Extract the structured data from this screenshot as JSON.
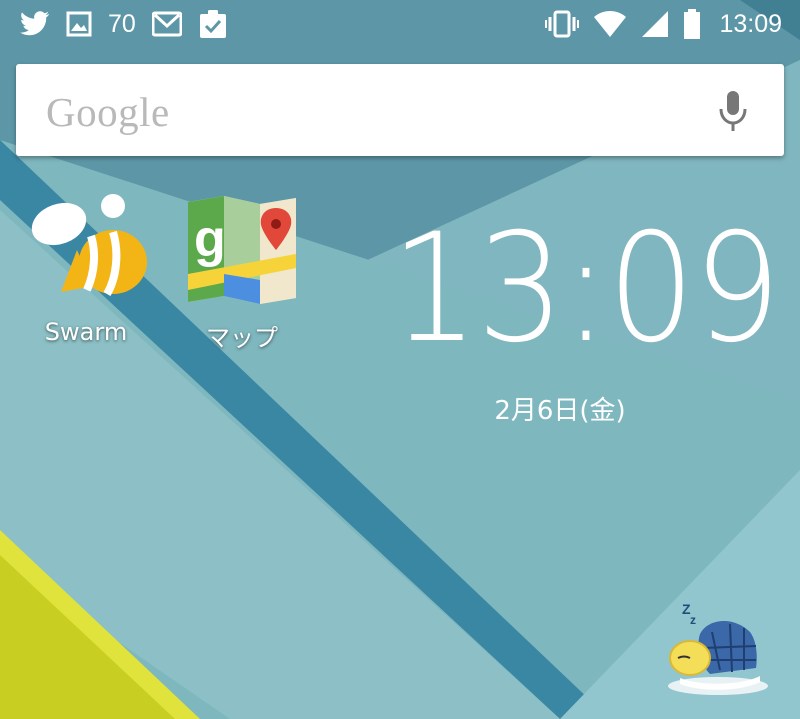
{
  "status_bar": {
    "notification_count": "70",
    "time": "13:09",
    "left_icons": [
      "twitter-icon",
      "image-icon",
      "gmail-icon",
      "clipboard-check-icon"
    ],
    "right_icons": [
      "vibrate-icon",
      "wifi-icon",
      "cell-signal-icon",
      "battery-icon"
    ]
  },
  "search": {
    "logo": "Google",
    "mic_icon": "mic-icon"
  },
  "apps": [
    {
      "label": "Swarm",
      "icon": "swarm-bee-icon"
    },
    {
      "label": "マップ",
      "icon": "google-maps-icon"
    }
  ],
  "clock": {
    "time": "13:09",
    "date": "2月6日(金)"
  },
  "colors": {
    "wallpaper": "#86bcc3",
    "stripe": "#3e8aa5",
    "accent_yellow": "#d9e022"
  }
}
